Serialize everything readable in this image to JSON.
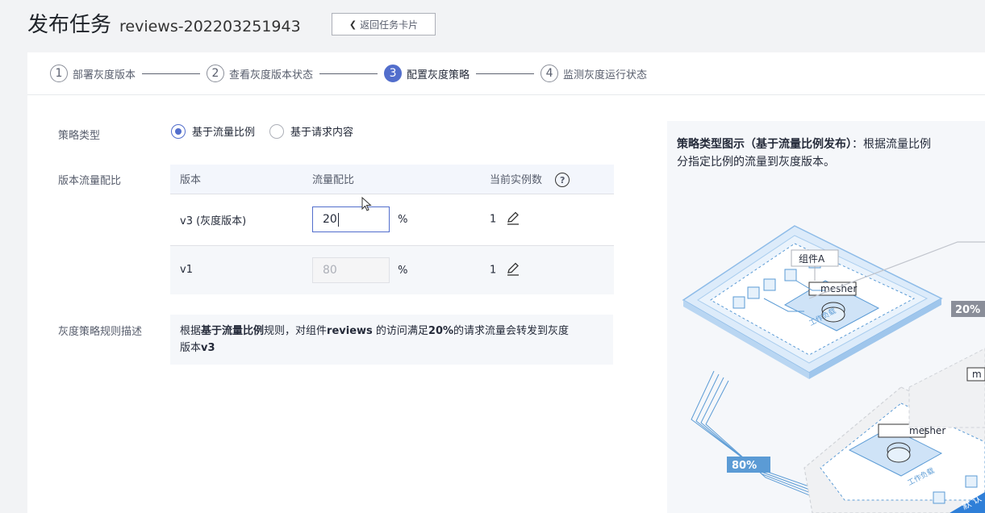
{
  "header": {
    "title": "发布任务",
    "task_name": "reviews-202203251943",
    "back_button": "返回任务卡片"
  },
  "steps": [
    {
      "num": "1",
      "label": "部署灰度版本"
    },
    {
      "num": "2",
      "label": "查看灰度版本状态"
    },
    {
      "num": "3",
      "label": "配置灰度策略",
      "active": true
    },
    {
      "num": "4",
      "label": "监测灰度运行状态"
    }
  ],
  "form": {
    "policy_type_label": "策略类型",
    "policy_options": [
      "基于流量比例",
      "基于请求内容"
    ],
    "policy_selected": "基于流量比例",
    "ratio_label": "版本流量配比",
    "table_headers": [
      "版本",
      "流量配比",
      "当前实例数"
    ],
    "rows": [
      {
        "version": "v3 (灰度版本)",
        "ratio": "20",
        "unit": "%",
        "instances": "1"
      },
      {
        "version": "v1",
        "ratio": "80",
        "unit": "%",
        "instances": "1"
      }
    ],
    "rule_label": "灰度策略规则描述",
    "rule_text": {
      "p1": "根据",
      "b1": "基于流量比例",
      "p2": "规则，对组件",
      "b2": "reviews",
      "p3": " 的访问满足",
      "b3": "20%",
      "p4": "的请求流量会转发到灰度",
      "p5": "版本",
      "b4": "v3"
    }
  },
  "diagram": {
    "title_bold": "策略类型图示（基于流量比例发布）",
    "title_text": "：根据流量比例",
    "title_line2": "分指定比例的流量到灰度版本。",
    "component_label": "组件A",
    "mesher_label_1": "mesher",
    "mesher_label_2": "mesher",
    "workload_label_1": "工作负载",
    "workload_label_2": "工作负载",
    "pct_top": "20%",
    "pct_bottom": "80%",
    "right_edge_label": "m",
    "default_label": "默 认"
  },
  "colors": {
    "accent": "#526ecc",
    "diagram_blue": "#5b9bd5",
    "diagram_light": "#cfe3f7"
  }
}
